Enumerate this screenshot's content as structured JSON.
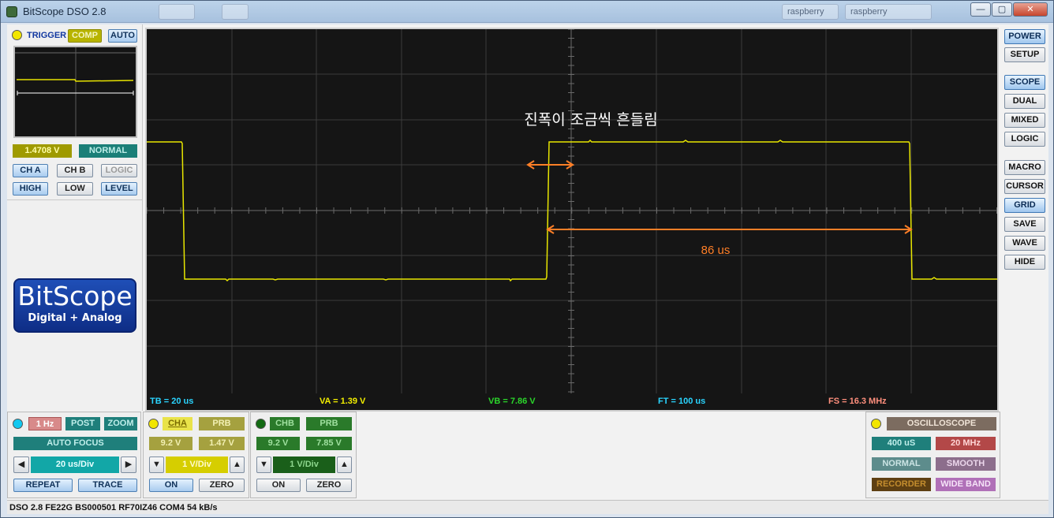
{
  "window": {
    "title": "BitScope DSO 2.8",
    "controls": {
      "minimize": "—",
      "maximize": "▢",
      "close": "✕"
    },
    "background_tabs": [
      "",
      "raspberry",
      "raspberry"
    ]
  },
  "trigger": {
    "label": "TRIGGER",
    "comp_label": "COMP",
    "auto_label": "AUTO",
    "level_value": "1.4708 V",
    "mode": "NORMAL",
    "buttons_row1": [
      "CH A",
      "CH B",
      "LOGIC"
    ],
    "buttons_row2": [
      "HIGH",
      "LOW",
      "LEVEL"
    ]
  },
  "logo": {
    "title": "BitScope",
    "subtitle": "Digital + Analog"
  },
  "scope": {
    "annotation_text": "진폭이 조금씩 흔들림",
    "annotation_measure": "86 us",
    "annotation_color": "#ff7f27",
    "trace_color": "#e8e600",
    "status": {
      "tb": "TB = 20 us",
      "va": "VA = 1.39 V",
      "vb": "VB = 7.86 V",
      "ft": "FT = 100 us",
      "fs": "FS = 16.3 MHz"
    }
  },
  "right_buttons": [
    "POWER",
    "SETUP",
    "SCOPE",
    "DUAL",
    "MIXED",
    "LOGIC",
    "MACRO",
    "CURSOR",
    "GRID",
    "SAVE",
    "WAVE",
    "HIDE"
  ],
  "timebase": {
    "freq": "1 Hz",
    "post": "POST",
    "zoom": "ZOOM",
    "auto_focus": "AUTO FOCUS",
    "value": "20 us/Div",
    "left_arrow": "◀",
    "right_arrow": "▶",
    "repeat": "REPEAT",
    "trace": "TRACE"
  },
  "channel_a": {
    "name": "CHA",
    "probe": "PRB",
    "range": "9.2 V",
    "offset": "1.47 V",
    "volts_div": "1 V/Div",
    "down": "▼",
    "up": "▲",
    "on": "ON",
    "zero": "ZERO"
  },
  "channel_b": {
    "name": "CHB",
    "probe": "PRB",
    "range": "9.2 V",
    "offset": "7.85 V",
    "volts_div": "1 V/Div",
    "down": "▼",
    "up": "▲",
    "on": "ON",
    "zero": "ZERO"
  },
  "mode_panel": {
    "title": "OSCILLOSCOPE",
    "sample": "400 uS",
    "bandwidth": "20 MHz",
    "normal": "NORMAL",
    "smooth": "SMOOTH",
    "recorder": "RECORDER",
    "wide_band": "WIDE BAND"
  },
  "footer": {
    "status": "DSO 2.8 FE22G BS000501 RF70IZ46 COM4 54 kB/s"
  }
}
